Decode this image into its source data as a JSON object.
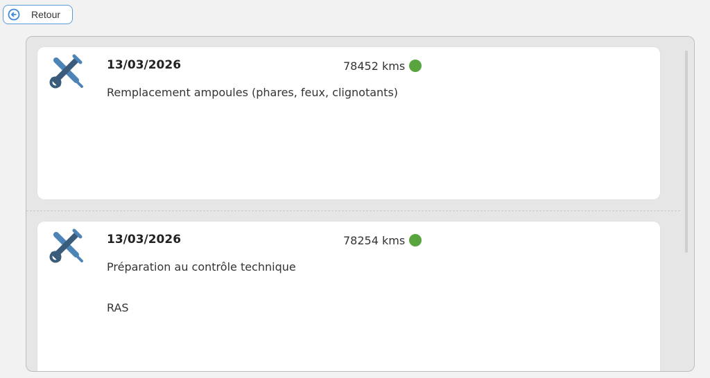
{
  "navigation": {
    "back_label": "Retour"
  },
  "records": [
    {
      "date": "13/03/2026",
      "mileage": "78452 kms",
      "description": "Remplacement ampoules (phares, feux, clignotants)",
      "note": "",
      "status_color": "#5aa43f",
      "icon": "tools-icon"
    },
    {
      "date": "13/03/2026",
      "mileage": "78254 kms",
      "description": "Préparation au contrôle technique",
      "note": "RAS",
      "status_color": "#5aa43f",
      "icon": "tools-icon"
    }
  ],
  "colors": {
    "tool_primary": "#4d84b7",
    "tool_secondary": "#3a5b7a"
  }
}
